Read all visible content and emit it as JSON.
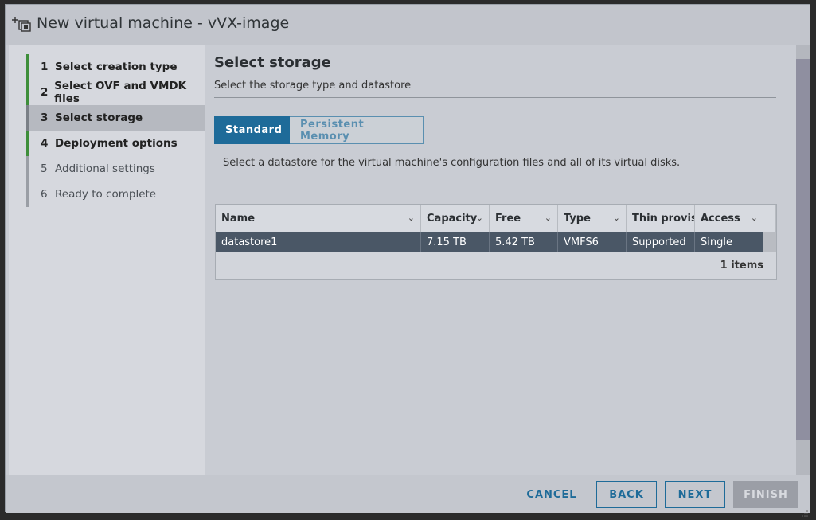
{
  "window": {
    "title": "New virtual machine - vVX-image",
    "icon": "add-vm-icon"
  },
  "wizard": {
    "steps": [
      {
        "num": "1",
        "label": "Select creation type",
        "state": "done"
      },
      {
        "num": "2",
        "label": "Select OVF and VMDK files",
        "state": "done"
      },
      {
        "num": "3",
        "label": "Select storage",
        "state": "current"
      },
      {
        "num": "4",
        "label": "Deployment options",
        "state": "done"
      },
      {
        "num": "5",
        "label": "Additional settings",
        "state": "todo"
      },
      {
        "num": "6",
        "label": "Ready to complete",
        "state": "todo"
      }
    ]
  },
  "page": {
    "title": "Select storage",
    "subtitle": "Select the storage type and datastore",
    "toggle": {
      "standard": "Standard",
      "persistent": "Persistent Memory",
      "selected": "Standard"
    },
    "description": "Select a datastore for the virtual machine's configuration files and all of its virtual disks."
  },
  "table": {
    "columns": [
      "Name",
      "Capacity",
      "Free",
      "Type",
      "Thin provisio",
      "Access"
    ],
    "rows": [
      [
        "datastore1",
        "7.15 TB",
        "5.42 TB",
        "VMFS6",
        "Supported",
        "Single"
      ]
    ],
    "footer": "1 items"
  },
  "buttons": {
    "cancel": "CANCEL",
    "back": "BACK",
    "next": "NEXT",
    "finish": "FINISH"
  },
  "colors": {
    "accent": "#1e6b99",
    "done_step": "#3e8e3a",
    "selected_row": "#4a5766"
  }
}
